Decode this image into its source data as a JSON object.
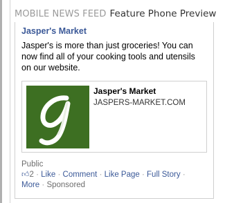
{
  "header": {
    "label": "MOBILE NEWS FEED",
    "title": "Feature Phone Preview"
  },
  "post": {
    "page_name": "Jasper's Market",
    "text": "Jasper's is more than just groceries! You can now find all of your cooking tools and utensils on our website.",
    "link_preview": {
      "logo_letter": "g",
      "logo_color": "#3d6f22",
      "title": "Jasper's Market",
      "domain": "JASPERS-MARKET.COM"
    },
    "privacy": "Public",
    "actions": {
      "like_icon": "thumbs-up-icon",
      "like_count": "2",
      "like": "Like",
      "comment": "Comment",
      "like_page": "Like Page",
      "full_story": "Full Story",
      "more": "More",
      "separator": "·",
      "sponsored": "Sponsored"
    }
  },
  "colors": {
    "link": "#3b5998",
    "muted": "#6d6d6d",
    "border": "#cfcfcf"
  }
}
